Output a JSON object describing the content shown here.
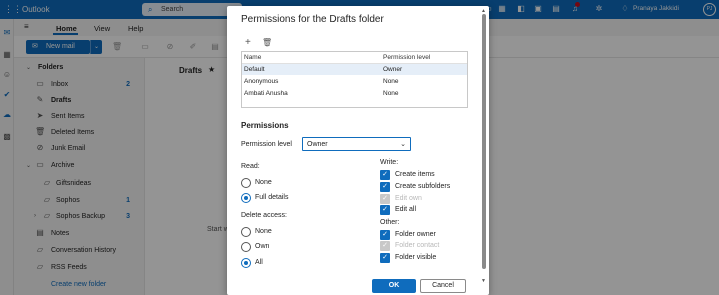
{
  "topbar": {
    "app_title": "Outlook",
    "search_placeholder": "Search",
    "user_name": "Pranaya Jakkidi",
    "user_initials": "PJ",
    "icons": [
      "waffle-icon",
      "search-icon",
      "chat-icon",
      "calendar-icon",
      "outlook-icon",
      "excel-icon",
      "teams-icon",
      "bell-icon",
      "gear-icon",
      "lightbulb-icon"
    ]
  },
  "ribbon": {
    "tabs": [
      "Home",
      "View",
      "Help"
    ],
    "active_tab": "Home",
    "new_mail_label": "New mail"
  },
  "folders": {
    "header": "Folders",
    "items": [
      {
        "label": "Inbox",
        "count": "2",
        "icon": "inbox-icon"
      },
      {
        "label": "Drafts",
        "count": "",
        "icon": "pencil-icon"
      },
      {
        "label": "Sent Items",
        "count": "",
        "icon": "send-icon"
      },
      {
        "label": "Deleted Items",
        "count": "",
        "icon": "trash-icon"
      },
      {
        "label": "Junk Email",
        "count": "",
        "icon": "junk-icon"
      },
      {
        "label": "Archive",
        "count": "",
        "icon": "archive-icon"
      },
      {
        "label": "Giftsnideas",
        "count": "",
        "icon": "folder-icon"
      },
      {
        "label": "Sophos",
        "count": "1",
        "icon": "folder-icon"
      },
      {
        "label": "Sophos Backup",
        "count": "3",
        "icon": "folder-icon"
      },
      {
        "label": "Notes",
        "count": "",
        "icon": "notes-icon"
      },
      {
        "label": "Conversation History",
        "count": "",
        "icon": "folder-icon"
      },
      {
        "label": "RSS Feeds",
        "count": "",
        "icon": "folder-icon"
      }
    ],
    "create_new": "Create new folder"
  },
  "messagelist": {
    "title": "Drafts",
    "start_text": "Start w"
  },
  "dialog": {
    "title": "Permissions for the Drafts folder",
    "table": {
      "headers": [
        "Name",
        "Permission level"
      ],
      "rows": [
        {
          "name": "Default",
          "level": "Owner",
          "selected": true
        },
        {
          "name": "Anonymous",
          "level": "None",
          "selected": false
        },
        {
          "name": "Ambati Anusha",
          "level": "None",
          "selected": false
        }
      ]
    },
    "permissions_heading": "Permissions",
    "permission_level_label": "Permission level",
    "permission_level_value": "Owner",
    "read": {
      "label": "Read:",
      "options": [
        "None",
        "Full details"
      ],
      "selected": "Full details"
    },
    "delete_access": {
      "label": "Delete access:",
      "options": [
        "None",
        "Own",
        "All"
      ],
      "selected": "All"
    },
    "write": {
      "label": "Write:",
      "items": [
        {
          "label": "Create items",
          "checked": true,
          "disabled": false
        },
        {
          "label": "Create subfolders",
          "checked": true,
          "disabled": false
        },
        {
          "label": "Edit own",
          "checked": true,
          "disabled": true
        },
        {
          "label": "Edit all",
          "checked": true,
          "disabled": false
        }
      ]
    },
    "other": {
      "label": "Other:",
      "items": [
        {
          "label": "Folder owner",
          "checked": true,
          "disabled": false
        },
        {
          "label": "Folder contact",
          "checked": true,
          "disabled": true
        },
        {
          "label": "Folder visible",
          "checked": true,
          "disabled": false
        }
      ]
    },
    "ok_label": "OK",
    "cancel_label": "Cancel"
  },
  "colors": {
    "accent": "#0f6cbd",
    "overlay": "rgba(0,0,0,0.42)"
  }
}
